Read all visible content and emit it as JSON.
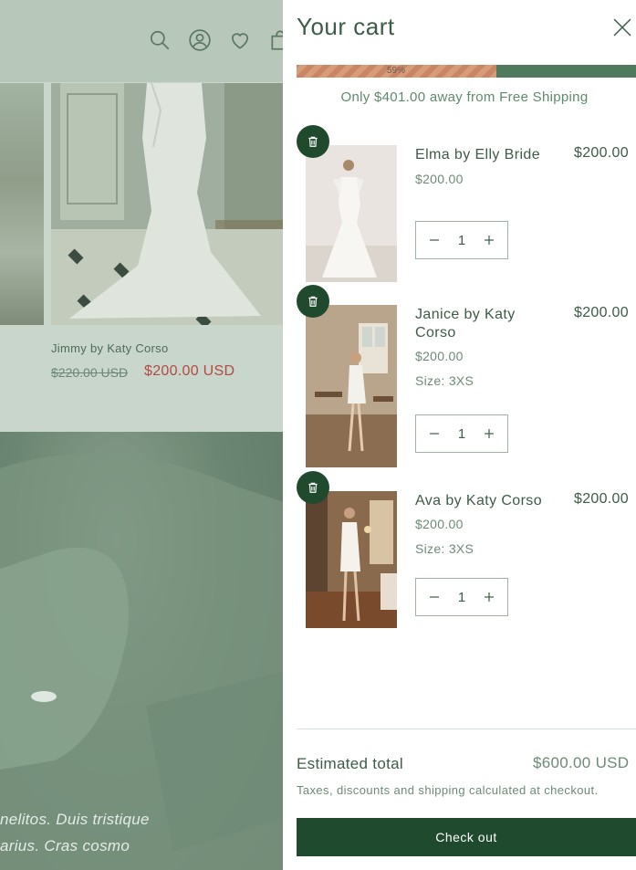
{
  "background": {
    "header_icons": [
      "search-icon",
      "account-icon",
      "wishlist-heart-icon",
      "cart-bag-icon"
    ],
    "product": {
      "title": "Jimmy by Katy Corso",
      "compare_price": "$220.00 USD",
      "price": "$200.00 USD"
    },
    "hero_lines": [
      "nelitos. Duis tristique",
      "arius. Cras cosmo"
    ]
  },
  "cart": {
    "title": "Your cart",
    "close_icon": "close-icon",
    "progress": {
      "percent_label": "59%",
      "fraction": 0.59
    },
    "free_shipping_message": "Only $401.00 away from Free Shipping",
    "items": [
      {
        "name": "Elma by Elly Bride",
        "price": "$200.00",
        "size": "",
        "quantity": "1",
        "line_total": "$200.00"
      },
      {
        "name": "Janice by Katy Corso",
        "price": "$200.00",
        "size": "Size: 3XS",
        "quantity": "1",
        "line_total": "$200.00"
      },
      {
        "name": "Ava by Katy Corso",
        "price": "$200.00",
        "size": "Size: 3XS",
        "quantity": "1",
        "line_total": "$200.00"
      }
    ],
    "estimated_total_label": "Estimated total",
    "estimated_total_value": "$600.00 USD",
    "tax_note": "Taxes, discounts and shipping calculated at checkout.",
    "checkout_label": "Check out"
  },
  "colors": {
    "brand_green": "#1f4a2e",
    "progress_done": "#d79c7a",
    "progress_track": "#4f7a5e",
    "sale_red": "#b14b43"
  }
}
